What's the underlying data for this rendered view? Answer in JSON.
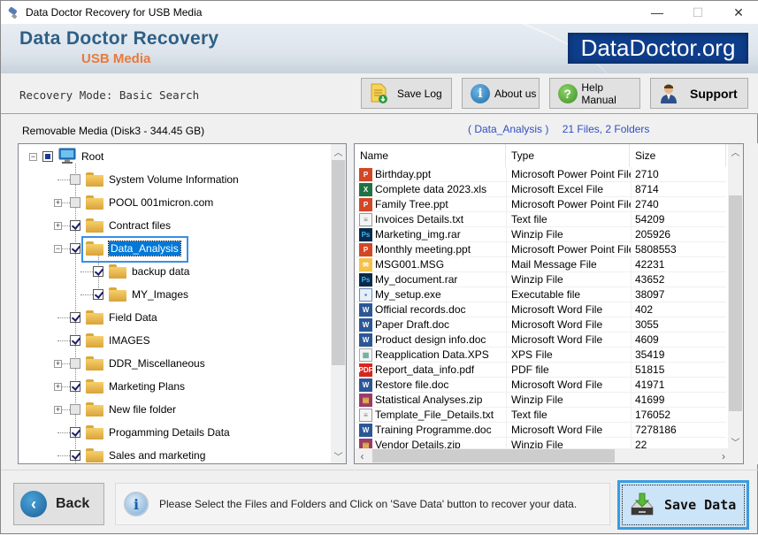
{
  "window": {
    "title": "Data Doctor Recovery for USB Media",
    "minimize": "—",
    "maximize": "☐",
    "close": "✕"
  },
  "banner": {
    "title": "Data Doctor Recovery",
    "subtitle": "USB Media",
    "logo_text": "DataDoctor.org"
  },
  "toolbar": {
    "mode_text": "Recovery Mode: Basic Search",
    "buttons": [
      {
        "label": "Save Log",
        "icon": "save-log-icon"
      },
      {
        "label": "About us",
        "icon": "info-icon"
      },
      {
        "label": "Help Manual",
        "icon": "help-icon"
      },
      {
        "label": "Support",
        "icon": "support-person-icon"
      }
    ]
  },
  "tree_panel": {
    "drive_label": "Removable Media (Disk3 - 344.45 GB)",
    "root": {
      "label": "Root",
      "state": "partial",
      "expanded": true
    },
    "items": [
      {
        "label": "System Volume Information",
        "state": "unchecked",
        "expander": "none",
        "level": 1
      },
      {
        "label": "POOL 001micron.com",
        "state": "unchecked",
        "expander": "plus",
        "level": 1
      },
      {
        "label": "Contract files",
        "state": "checked",
        "expander": "plus",
        "level": 1
      },
      {
        "label": "Data_Analysis",
        "state": "checked",
        "expander": "minus",
        "level": 1,
        "selected": true
      },
      {
        "label": "backup data",
        "state": "checked",
        "expander": "none",
        "level": 2
      },
      {
        "label": "MY_Images",
        "state": "checked",
        "expander": "none",
        "level": 2
      },
      {
        "label": "Field Data",
        "state": "checked",
        "expander": "none",
        "level": 1
      },
      {
        "label": "IMAGES",
        "state": "checked",
        "expander": "none",
        "level": 1
      },
      {
        "label": "DDR_Miscellaneous",
        "state": "unchecked",
        "expander": "plus",
        "level": 1
      },
      {
        "label": "Marketing Plans",
        "state": "checked",
        "expander": "plus",
        "level": 1
      },
      {
        "label": "New file folder",
        "state": "unchecked",
        "expander": "plus",
        "level": 1
      },
      {
        "label": "Progamming Details Data",
        "state": "checked",
        "expander": "none",
        "level": 1
      },
      {
        "label": "Sales and marketing",
        "state": "checked",
        "expander": "none",
        "level": 1
      }
    ]
  },
  "file_panel": {
    "folder_label": "( Data_Analysis )",
    "count_label": "21 Files, 2 Folders",
    "columns": [
      "Name",
      "Type",
      "Size"
    ],
    "files": [
      {
        "name": "Birthday.ppt",
        "type": "Microsoft Power Point File",
        "size": "2710",
        "icon": "ppt"
      },
      {
        "name": "Complete data 2023.xls",
        "type": "Microsoft Excel File",
        "size": "8714",
        "icon": "xls"
      },
      {
        "name": "Family Tree.ppt",
        "type": "Microsoft Power Point File",
        "size": "2740",
        "icon": "ppt"
      },
      {
        "name": "Invoices Details.txt",
        "type": "Text file",
        "size": "54209",
        "icon": "txt"
      },
      {
        "name": "Marketing_img.rar",
        "type": "Winzip File",
        "size": "205926",
        "icon": "ps"
      },
      {
        "name": "Monthly meeting.ppt",
        "type": "Microsoft Power Point File",
        "size": "5808553",
        "icon": "ppt"
      },
      {
        "name": "MSG001.MSG",
        "type": "Mail Message File",
        "size": "42231",
        "icon": "msg"
      },
      {
        "name": "My_document.rar",
        "type": "Winzip File",
        "size": "43652",
        "icon": "ps"
      },
      {
        "name": "My_setup.exe",
        "type": "Executable file",
        "size": "38097",
        "icon": "exe"
      },
      {
        "name": "Official records.doc",
        "type": "Microsoft Word File",
        "size": "402",
        "icon": "doc"
      },
      {
        "name": "Paper Draft.doc",
        "type": "Microsoft Word File",
        "size": "3055",
        "icon": "doc"
      },
      {
        "name": "Product design info.doc",
        "type": "Microsoft Word File",
        "size": "4609",
        "icon": "doc"
      },
      {
        "name": "Reapplication Data.XPS",
        "type": "XPS File",
        "size": "35419",
        "icon": "xps"
      },
      {
        "name": "Report_data_info.pdf",
        "type": "PDF file",
        "size": "51815",
        "icon": "pdf"
      },
      {
        "name": "Restore file.doc",
        "type": "Microsoft Word File",
        "size": "41971",
        "icon": "doc"
      },
      {
        "name": "Statistical Analyses.zip",
        "type": "Winzip File",
        "size": "41699",
        "icon": "zip"
      },
      {
        "name": "Template_File_Details.txt",
        "type": "Text file",
        "size": "176052",
        "icon": "txt"
      },
      {
        "name": "Training Programme.doc",
        "type": "Microsoft Word File",
        "size": "7278186",
        "icon": "doc"
      },
      {
        "name": "Vendor Details.zip",
        "type": "Winzip File",
        "size": "22",
        "icon": "zip"
      }
    ]
  },
  "bottom": {
    "back_label": "Back",
    "info_message": "Please Select the Files and Folders and Click on 'Save Data' button to recover your data.",
    "save_label": "Save Data"
  },
  "colors": {
    "banner_title": "#2e5f86",
    "banner_subtitle": "#e87a3c",
    "logo_bg": "#0e3d8a",
    "selection": "#0078d7",
    "header_link": "#2f4ec4",
    "save_button_bg": "#cce4f7",
    "save_button_border": "#3a9ce0"
  }
}
